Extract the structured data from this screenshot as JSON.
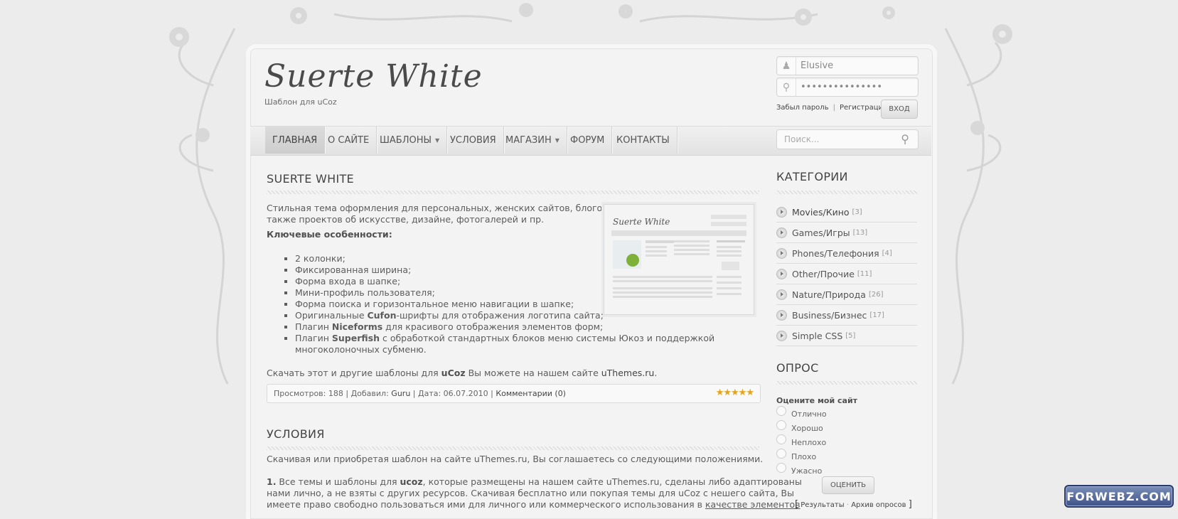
{
  "header": {
    "logo": "Suerte White",
    "subtitle": "Шаблон для uCoz",
    "username_value": "Elusive",
    "password_value": "•••••••••••••••",
    "forgot_link": "Забыл пароль",
    "register_link": "Регистрация",
    "login_button": "ВХОД"
  },
  "nav": {
    "items": [
      "ГЛАВНАЯ",
      "О САЙТЕ",
      "ШАБЛОНЫ",
      "УСЛОВИЯ",
      "МАГАЗИН",
      "ФОРУМ",
      "КОНТАКТЫ"
    ],
    "search_placeholder": "Поиск..."
  },
  "article": {
    "title": "SUERTE WHITE",
    "intro_line1": "Стильная тема оформления для персональных, женских сайтов, блогов, а",
    "intro_line2": "также проектов об искусстве, дизайне, фотогалерей и пр.",
    "features_heading": "Ключевые особенности:",
    "features": [
      "2 колонки;",
      "Фиксированная ширина;",
      "Форма входа в шапке;",
      "Мини-профиль пользователя;",
      "Форма поиска и горизонтальное меню навигации в шапке;"
    ],
    "feature_cufon_pre": "Оригинальные ",
    "feature_cufon_bold": "Cufon",
    "feature_cufon_post": "-шрифты для отображения логотипа сайта;",
    "feature_nice_pre": "Плагин ",
    "feature_nice_bold": "Niceforms",
    "feature_nice_post": " для красивого отображения элементов форм;",
    "feature_super_pre": "Плагин ",
    "feature_super_bold": "Superfish",
    "feature_super_post": " с обработкой стандартных блоков меню системы Юкоз и поддержкой многоколоночных субменю.",
    "download_pre": "Скачать этот и другие шаблоны для ",
    "download_bold": "uCoz",
    "download_mid": " Вы можете на нашем сайте ",
    "download_link": "uThemes.ru",
    "download_end": ".",
    "meta_views_label": "Просмотров: ",
    "meta_views": "188",
    "meta_added_label": " | Добавил: ",
    "meta_author": "Guru",
    "meta_date": " | Дата: 06.07.2010 | ",
    "meta_comments": "Комментарии (0)",
    "stars": "★★★★★",
    "rating": 5
  },
  "terms": {
    "title": "УСЛОВИЯ",
    "line1": "Скачивая или приобретая шаблон на сайте uThemes.ru, Вы соглашаетесь со следующими положениями.",
    "p1_num": "1.",
    "p1_a": " Все темы и шаблоны для ",
    "p1_bold": "ucoz",
    "p1_b": ", которые размещены на нашем сайте uThemes.ru, сделаны либо адаптированы",
    "p1_line2": "нами лично, а не взяты с других ресурсов. Скачивая бесплатно или покупая темы для uCoz с нешего сайта, Вы",
    "p1_line3": "имеете право свободно пользоваться ими для личного или коммерческого использования в ",
    "p1_link": "качестве элементов"
  },
  "sidebar": {
    "categories_title": "КАТЕГОРИИ",
    "categories": [
      {
        "name": "Movies/Кино",
        "count": "[3]"
      },
      {
        "name": "Games/Игры",
        "count": "[13]"
      },
      {
        "name": "Phones/Телефония",
        "count": "[4]"
      },
      {
        "name": "Other/Прочие",
        "count": "[11]"
      },
      {
        "name": "Nature/Природа",
        "count": "[26]"
      },
      {
        "name": "Business/Бизнес",
        "count": "[17]"
      },
      {
        "name": "Simple CSS",
        "count": "[5]"
      }
    ],
    "poll_title": "ОПРОС",
    "poll_question": "Оцените мой сайт",
    "poll_options": [
      "Отлично",
      "Хорошо",
      "Неплохо",
      "Плохо",
      "Ужасно"
    ],
    "poll_button": "ОЦЕНИТЬ",
    "poll_bracket_left": "[",
    "poll_results": "Результаты",
    "poll_dot": "·",
    "poll_archive": "Архив опросов",
    "poll_bracket_right": "]"
  },
  "watermark": "FORWEBZ.COM"
}
